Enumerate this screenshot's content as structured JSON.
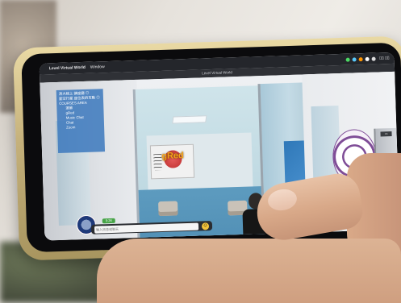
{
  "window": {
    "menubar_app": "Level Virtual World",
    "menubar_menu": "Window",
    "title": "Level Virtual World"
  },
  "scene": {
    "avatar_name_label": "gRed"
  },
  "side_menu": {
    "items": [
      "清大線上 講座廳 ◎",
      "星空行星 座位表的互動 ◎",
      "COURSES AREA",
      "選單",
      "gRed",
      "Music Chat",
      "Chat",
      "Zoom"
    ]
  },
  "chat": {
    "placeholder": "輸入訊息或聊天",
    "status": "0:26"
  },
  "colors": {
    "menu_panel": "#407bbe",
    "name_label": "#f4a11a",
    "menubar": "#24262b"
  }
}
